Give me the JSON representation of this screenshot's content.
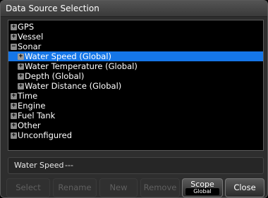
{
  "title": "Data Source Selection",
  "tree": [
    {
      "label": "GPS",
      "level": 0,
      "expander": "+",
      "selected": false
    },
    {
      "label": "Vessel",
      "level": 0,
      "expander": "+",
      "selected": false
    },
    {
      "label": "Sonar",
      "level": 0,
      "expander": "−",
      "selected": false
    },
    {
      "label": "Water Speed (Global)",
      "level": 1,
      "expander": "+",
      "selected": true
    },
    {
      "label": "Water Temperature (Global)",
      "level": 1,
      "expander": "+",
      "selected": false
    },
    {
      "label": "Depth (Global)",
      "level": 1,
      "expander": "+",
      "selected": false
    },
    {
      "label": "Water Distance (Global)",
      "level": 1,
      "expander": "+",
      "selected": false
    },
    {
      "label": "Time",
      "level": 0,
      "expander": "+",
      "selected": false
    },
    {
      "label": "Engine",
      "level": 0,
      "expander": "+",
      "selected": false
    },
    {
      "label": "Fuel Tank",
      "level": 0,
      "expander": "+",
      "selected": false
    },
    {
      "label": "Other",
      "level": 0,
      "expander": "+",
      "selected": false
    },
    {
      "label": "Unconfigured",
      "level": 0,
      "expander": "+",
      "selected": false
    }
  ],
  "status": {
    "label": "Water Speed",
    "value": "---"
  },
  "buttons": {
    "select": "Select",
    "rename": "Rename",
    "new": "New",
    "remove": "Remove",
    "scope": "Scope",
    "scope_value": "Global",
    "close": "Close"
  },
  "colors": {
    "selection": "#1576e8",
    "background": "#000000"
  }
}
